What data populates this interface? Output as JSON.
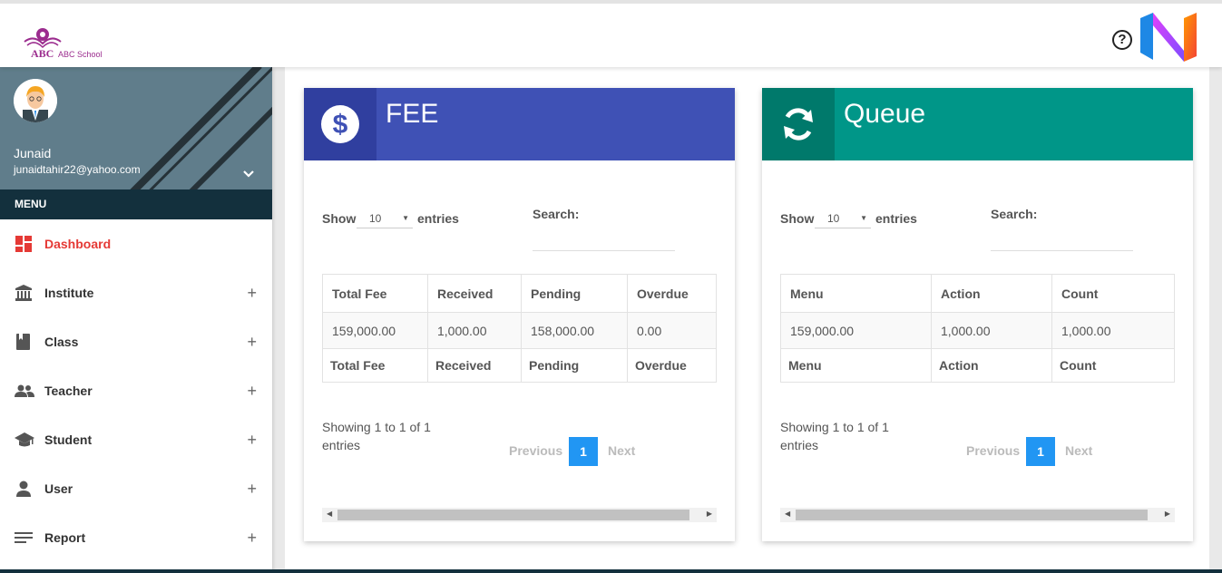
{
  "header": {
    "logo_abc": "ABC",
    "logo_school": "ABC School",
    "help_glyph": "?"
  },
  "sidebar": {
    "user": {
      "name": "Junaid",
      "email": "junaidtahir22@yahoo.com"
    },
    "menu_heading": "MENU",
    "items": [
      {
        "label": "Dashboard",
        "icon": "dashboard-icon",
        "expandable": false,
        "active": true
      },
      {
        "label": "Institute",
        "icon": "bank-icon",
        "expandable": true
      },
      {
        "label": "Class",
        "icon": "book-icon",
        "expandable": true
      },
      {
        "label": "Teacher",
        "icon": "people-icon",
        "expandable": true
      },
      {
        "label": "Student",
        "icon": "graduation-cap-icon",
        "expandable": true
      },
      {
        "label": "User",
        "icon": "person-icon",
        "expandable": true
      },
      {
        "label": "Report",
        "icon": "list-icon",
        "expandable": true
      }
    ],
    "plus_glyph": "+"
  },
  "colors": {
    "fee": "#3f51b5",
    "fee_dark": "#303f9f",
    "queue": "#009688",
    "queue_dark": "#00796b",
    "active": "#e53935",
    "page_current": "#2196f3"
  },
  "fee_card": {
    "title": "FEE",
    "show_label": "Show",
    "entries_value": "10",
    "entries_label": "entries",
    "search_label": "Search:",
    "columns": [
      "Total Fee",
      "Received",
      "Pending",
      "Overdue"
    ],
    "rows": [
      [
        "159,000.00",
        "1,000.00",
        "158,000.00",
        "0.00"
      ]
    ],
    "footer": [
      "Total Fee",
      "Received",
      "Pending",
      "Overdue"
    ],
    "showing_line1": "Showing 1 to 1 of 1",
    "showing_line2": "entries",
    "prev": "Previous",
    "current_page": "1",
    "next": "Next"
  },
  "queue_card": {
    "title": "Queue",
    "show_label": "Show",
    "entries_value": "10",
    "entries_label": "entries",
    "search_label": "Search:",
    "columns": [
      "Menu",
      "Action",
      "Count"
    ],
    "rows": [
      [
        "159,000.00",
        "1,000.00",
        "1,000.00"
      ]
    ],
    "footer": [
      "Menu",
      "Action",
      "Count"
    ],
    "showing_line1": "Showing 1 to 1 of 1",
    "showing_line2": "entries",
    "prev": "Previous",
    "current_page": "1",
    "next": "Next"
  }
}
